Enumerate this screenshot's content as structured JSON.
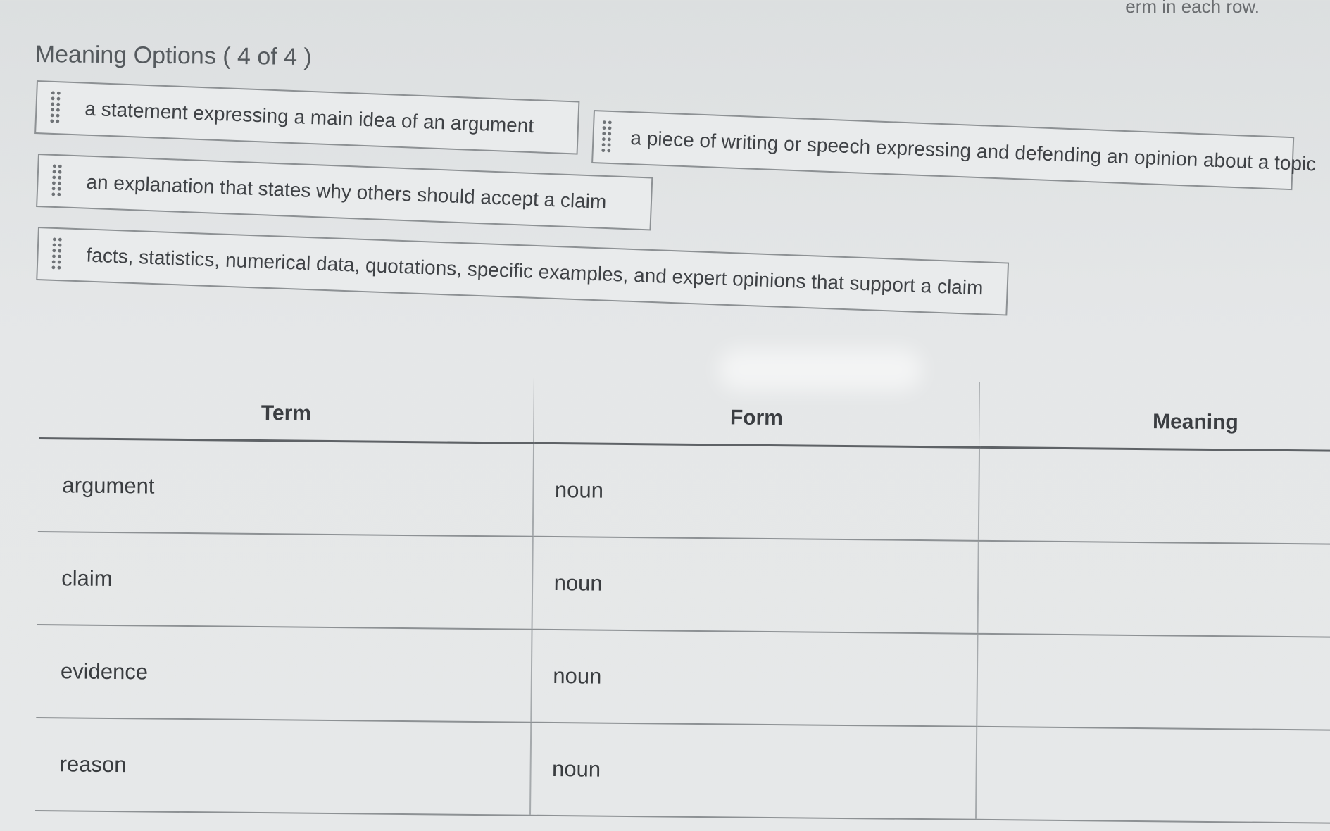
{
  "instruction_fragment": "erm in each row.",
  "options_panel": {
    "title": "Meaning Options ( 4 of 4 )",
    "options": [
      {
        "text": "a statement expressing a main idea of an argument"
      },
      {
        "text": "a piece of writing or speech expressing and defending an opinion about a topic"
      },
      {
        "text": "an explanation that states why others should accept a claim"
      },
      {
        "text": "facts, statistics, numerical data, quotations, specific examples, and expert opinions that support a claim"
      }
    ]
  },
  "table": {
    "headers": {
      "term": "Term",
      "form": "Form",
      "meaning": "Meaning"
    },
    "rows": [
      {
        "term": "argument",
        "form": "noun",
        "meaning": ""
      },
      {
        "term": "claim",
        "form": "noun",
        "meaning": ""
      },
      {
        "term": "evidence",
        "form": "noun",
        "meaning": ""
      },
      {
        "term": "reason",
        "form": "noun",
        "meaning": ""
      }
    ]
  },
  "icons": {
    "drag_handle": "drag-handle-icon"
  }
}
